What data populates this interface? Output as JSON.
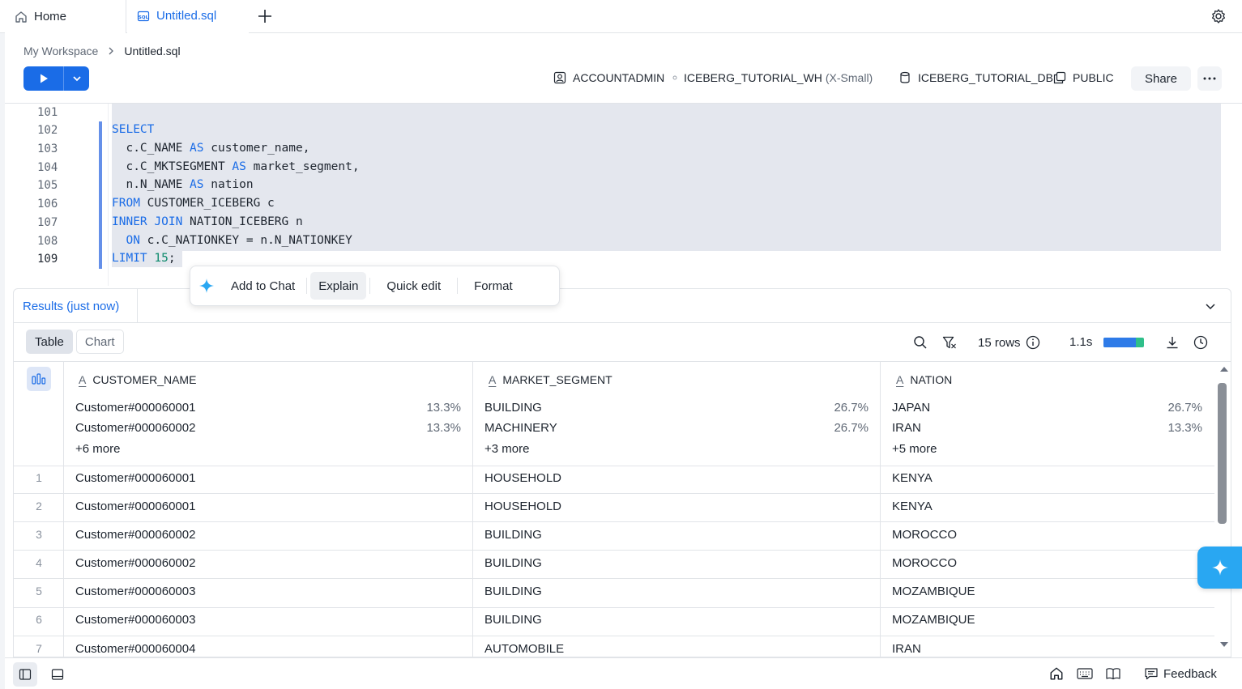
{
  "tabs": {
    "home": "Home",
    "sql": "Untitled.sql"
  },
  "breadcrumb": {
    "workspace": "My Workspace",
    "file": "Untitled.sql"
  },
  "context": {
    "role": "ACCOUNTADMIN",
    "warehouse": "ICEBERG_TUTORIAL_WH",
    "warehouse_size": "(X-Small)",
    "database": "ICEBERG_TUTORIAL_DB",
    "schema": "PUBLIC"
  },
  "toolbar": {
    "share_label": "Share"
  },
  "editor": {
    "line_numbers": [
      "101",
      "102",
      "103",
      "104",
      "105",
      "106",
      "107",
      "108",
      "109"
    ]
  },
  "ai_toolbar": {
    "add_to_chat": "Add to Chat",
    "explain": "Explain",
    "quick_edit": "Quick edit",
    "format": "Format"
  },
  "results": {
    "tab_label": "Results (just now)",
    "view_table": "Table",
    "view_chart": "Chart",
    "row_count": "15 rows",
    "duration": "1.1s",
    "progress_fraction": 0.8,
    "columns": [
      "CUSTOMER_NAME",
      "MARKET_SEGMENT",
      "NATION"
    ],
    "stats": {
      "customer_name": [
        {
          "value": "Customer#000060001",
          "pct": "13.3%"
        },
        {
          "value": "Customer#000060002",
          "pct": "13.3%"
        }
      ],
      "customer_name_more": "+6 more",
      "market_segment": [
        {
          "value": "BUILDING",
          "pct": "26.7%"
        },
        {
          "value": "MACHINERY",
          "pct": "26.7%"
        }
      ],
      "market_segment_more": "+3 more",
      "nation": [
        {
          "value": "JAPAN",
          "pct": "26.7%"
        },
        {
          "value": "IRAN",
          "pct": "13.3%"
        }
      ],
      "nation_more": "+5 more"
    },
    "rows": [
      {
        "n": "1",
        "customer": "Customer#000060001",
        "segment": "HOUSEHOLD",
        "nation": "KENYA"
      },
      {
        "n": "2",
        "customer": "Customer#000060001",
        "segment": "HOUSEHOLD",
        "nation": "KENYA"
      },
      {
        "n": "3",
        "customer": "Customer#000060002",
        "segment": "BUILDING",
        "nation": "MOROCCO"
      },
      {
        "n": "4",
        "customer": "Customer#000060002",
        "segment": "BUILDING",
        "nation": "MOROCCO"
      },
      {
        "n": "5",
        "customer": "Customer#000060003",
        "segment": "BUILDING",
        "nation": "MOZAMBIQUE"
      },
      {
        "n": "6",
        "customer": "Customer#000060003",
        "segment": "BUILDING",
        "nation": "MOZAMBIQUE"
      },
      {
        "n": "7",
        "customer": "Customer#000060004",
        "segment": "AUTOMOBILE",
        "nation": "IRAN"
      }
    ]
  },
  "footer": {
    "feedback": "Feedback"
  },
  "colors": {
    "accent": "#1a6ce7",
    "ai_fab": "#29a7f2",
    "selection": "#e4e7ee"
  },
  "icons": [
    "home-icon",
    "sql-file-icon",
    "plus-icon",
    "gear-icon",
    "play-icon",
    "chevron-down-icon",
    "user-role-icon",
    "database-icon",
    "schema-icon",
    "ellipsis-icon",
    "sparkle-icon",
    "search-icon",
    "filter-icon",
    "info-icon",
    "download-icon",
    "history-icon",
    "column-stats-icon",
    "sidebar-icon",
    "panel-icon",
    "keyboard-icon",
    "book-icon",
    "feedback-icon"
  ]
}
